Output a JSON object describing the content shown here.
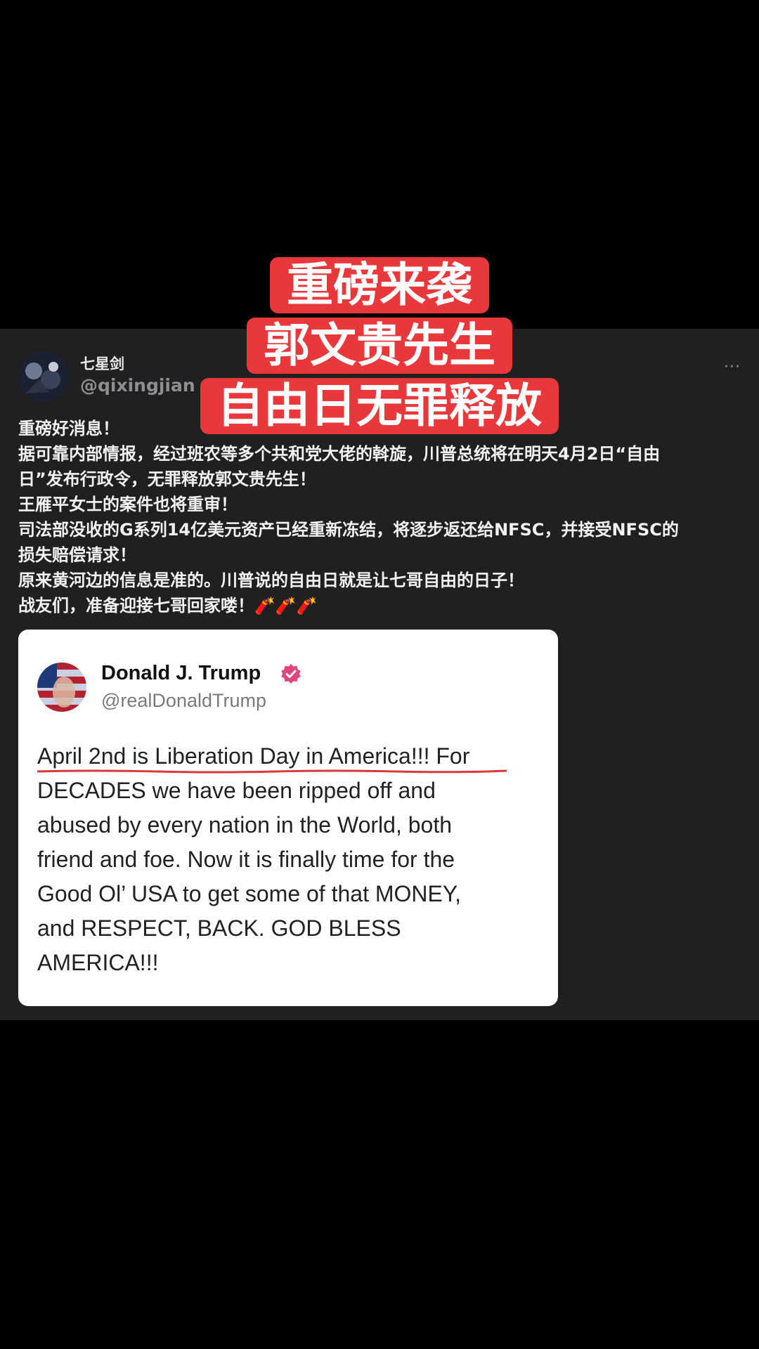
{
  "post": {
    "author": {
      "name": "七星剑",
      "handle": "@qixingjian"
    },
    "lines": [
      "重磅好消息！",
      "据可靠内部情报，经过班农等多个共和党大佬的斡旋，川普总统将在明天4月2日“自由",
      "日”发布行政令，无罪释放郭文贵先生！",
      "王雁平女士的案件也将重审！",
      "司法部没收的G系列14亿美元资产已经重新冻结，将逐步返还给NFSC，并接受NFSC的",
      "损失赔偿请求！",
      "原来黄河边的信息是准的。川普说的自由日就是让七哥自由的日子！",
      "战友们，准备迎接七哥回家喽！🧨🧨🧨"
    ]
  },
  "embedded_card": {
    "name": "Donald J. Trump",
    "handle": "@realDonaldTrump",
    "lines": [
      "April 2nd is Liberation Day in America!!! For",
      "DECADES we have been ripped off and",
      "abused by every nation in the World, both",
      "friend and foe. Now it is finally time for the",
      "Good Ol’ USA to get some of that MONEY,",
      "and RESPECT, BACK. GOD BLESS",
      "AMERICA!!!"
    ]
  },
  "headline": {
    "lines": [
      "重磅来袭",
      "郭文贵先生",
      "自由日无罪释放"
    ]
  },
  "colors": {
    "headline_bg": "#e8383b",
    "verified": "#e0457b",
    "underline": "#d83a3a"
  },
  "icons": [
    "more-icon",
    "verified-icon"
  ]
}
